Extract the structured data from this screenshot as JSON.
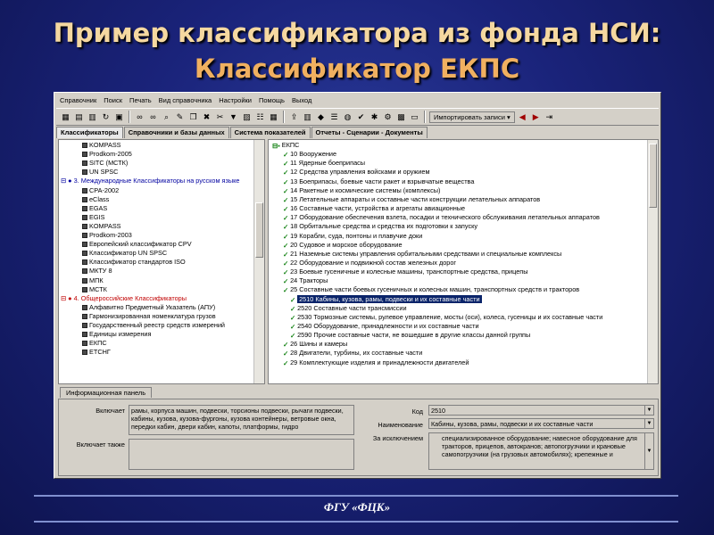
{
  "slide": {
    "title_line1": "Пример классификатора из фонда НСИ:",
    "title_line2": "Классификатор ЕКПС",
    "footer": "ФГУ «ФЦК»"
  },
  "menu": [
    "Справочник",
    "Поиск",
    "Печать",
    "Вид справочника",
    "Настройки",
    "Помощь",
    "Выход"
  ],
  "toolbar": {
    "import_label": "Импортировать записи"
  },
  "tabs": [
    "Классификаторы",
    "Справочники и базы данных",
    "Система показателей",
    "Отчеты - Сценарии - Документы"
  ],
  "left_tree": [
    {
      "text": "KOMPASS"
    },
    {
      "text": "Prodkom-2005"
    },
    {
      "text": "SITC (МСТК)"
    },
    {
      "text": "UN SPSC"
    },
    {
      "text": "3. Международные Классификаторы на русском языке",
      "style": "blue"
    },
    {
      "text": "CPA-2002"
    },
    {
      "text": "eClass"
    },
    {
      "text": "EGAS"
    },
    {
      "text": "EGIS"
    },
    {
      "text": "KOMPASS"
    },
    {
      "text": "Prodkom-2003"
    },
    {
      "text": "Европейский классификатор CPV"
    },
    {
      "text": "Классификатор UN SPSC"
    },
    {
      "text": "Классификатор стандартов ISO"
    },
    {
      "text": "МКТУ 8"
    },
    {
      "text": "МПК"
    },
    {
      "text": "МСТК"
    },
    {
      "text": "4. Общероссийские Классификаторы",
      "style": "red"
    },
    {
      "text": "Алфавитно Предметный Указатель (АПУ)"
    },
    {
      "text": "Гармонизированная номенклатура грузов"
    },
    {
      "text": "Государственный реестр средств измерений"
    },
    {
      "text": "Единицы измерения"
    },
    {
      "text": "ЕКПС"
    },
    {
      "text": "ЕТСНГ"
    }
  ],
  "right_tree": [
    {
      "text": "ЕКПС",
      "root": true
    },
    {
      "text": "10 Вооружение"
    },
    {
      "text": "11 Ядерные боеприпасы"
    },
    {
      "text": "12 Средства управления войсками и оружием"
    },
    {
      "text": "13 Боеприпасы, боевые части ракет и взрывчатые вещества"
    },
    {
      "text": "14 Ракетные и космические системы (комплексы)"
    },
    {
      "text": "15 Летательные аппараты и составные части конструкции летательных аппаратов"
    },
    {
      "text": "16 Составные части, устройства и агрегаты авиационные"
    },
    {
      "text": "17 Оборудование обеспечения взлета, посадки и технического обслуживания летательных аппаратов"
    },
    {
      "text": "18 Орбитальные средства и средства их подготовки к запуску"
    },
    {
      "text": "19 Корабли, суда, понтоны и плавучие доки"
    },
    {
      "text": "20 Судовое и морское оборудование"
    },
    {
      "text": "21 Наземные системы управления орбитальными средствами и специальные комплексы"
    },
    {
      "text": "22 Оборудование и подвижной состав железных дорог"
    },
    {
      "text": "23 Боевые гусеничные и колесные машины, транспортные средства, прицепы"
    },
    {
      "text": "24 Тракторы"
    },
    {
      "text": "25 Составные части боевых гусеничных и колесных машин, транспортных средств и тракторов"
    },
    {
      "text": "2510 Кабины, кузова, рамы, подвески и их составные части",
      "child": true,
      "selected": true
    },
    {
      "text": "2520 Составные части трансмиссии",
      "child": true
    },
    {
      "text": "2530 Тормозные системы, рулевое управление, мосты (оси), колеса, гусеницы и их составные части",
      "child": true
    },
    {
      "text": "2540 Оборудование, принадлежности и их составные части",
      "child": true
    },
    {
      "text": "2590 Прочие составные части, не вошедшие в другие классы данной группы",
      "child": true
    },
    {
      "text": "26 Шины и камеры"
    },
    {
      "text": "28 Двигатели, турбины, их составные части"
    },
    {
      "text": "29 Комплектующие изделия и принадлежности двигателей"
    }
  ],
  "info_panel": {
    "tab_label": "Информационная панель",
    "includes_label": "Включает",
    "includes_value": "рамы, корпуса машин, подвески, торсионы подвески, рычаги подвески, кабины, кузова, кузова-фургоны, кузова контейнеры, ветровые окна, передки кабин, двери кабин, капоты, платформы, гидро",
    "also_includes_label": "Включает также",
    "also_includes_value": "",
    "code_label": "Код",
    "code_value": "2510",
    "name_label": "Наименование",
    "name_value": "Кабины, кузова, рамы, подвески и их составные части",
    "exclusion_label": "За исключением",
    "exclusion_value": "специализированное оборудование; навесное оборудование для тракторов, прицепов, автокранов; автопогрузчики и крановые самопогрузчики (на грузовых автомобилях); крепежные и"
  }
}
